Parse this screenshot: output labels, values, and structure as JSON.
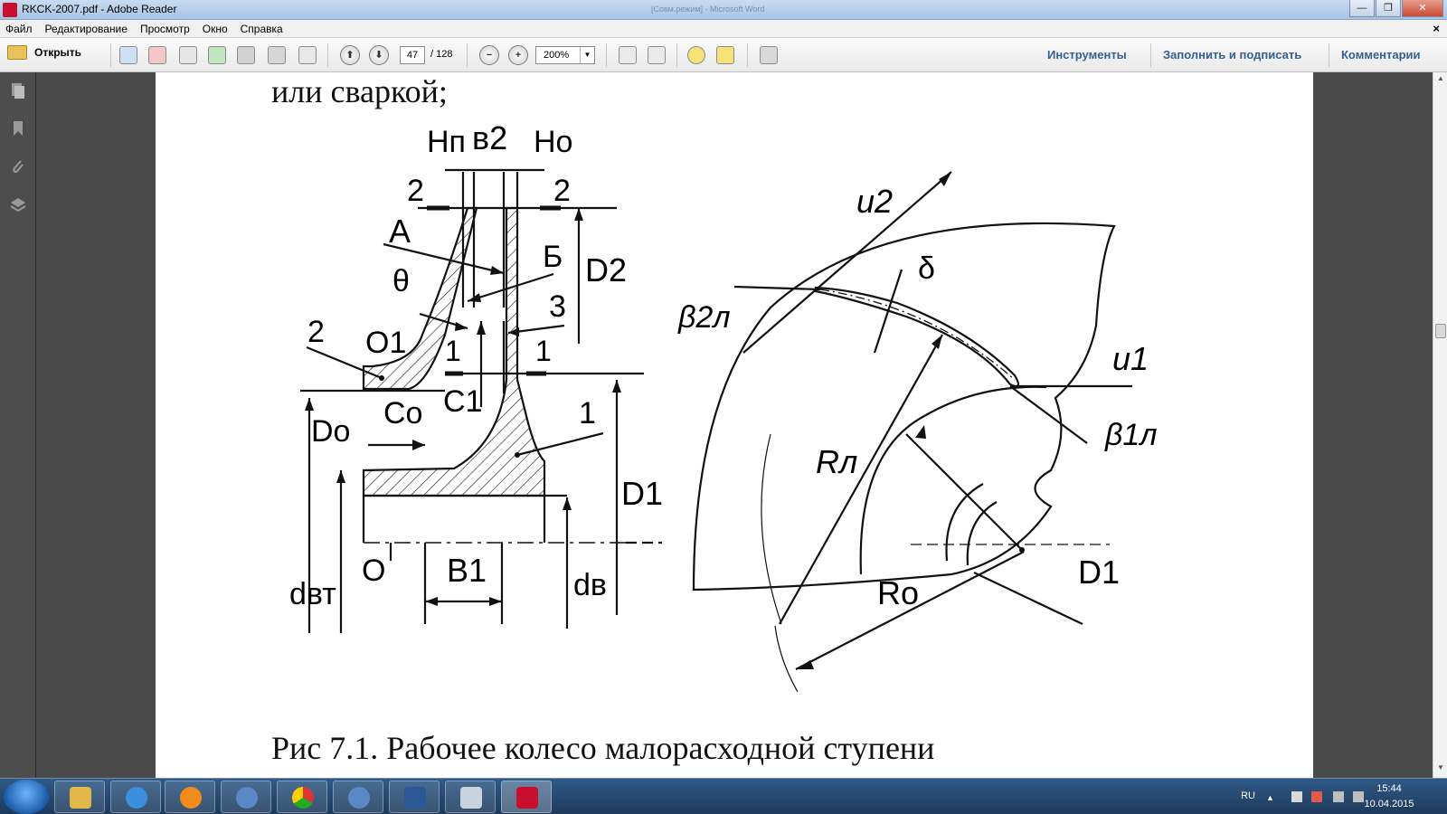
{
  "window": {
    "title": "RKCK-2007.pdf - Adobe Reader",
    "background_title": "[Совм.режим] - Microsoft Word",
    "buttons": {
      "minimize": "—",
      "maximize": "❐",
      "close": "✕"
    }
  },
  "menu": {
    "items": [
      "Файл",
      "Редактирование",
      "Просмотр",
      "Окно",
      "Справка"
    ],
    "close_glyph": "×"
  },
  "toolbar": {
    "open_label": "Открыть",
    "page_current": "47",
    "page_total": "/ 128",
    "zoom": "200%",
    "zoom_out": "−",
    "zoom_in": "+",
    "prev_page": "⬆",
    "next_page": "⬇",
    "tools_label": "Инструменты",
    "fill_sign_label": "Заполнить и подписать",
    "comments_label": "Комментарии"
  },
  "document": {
    "top_text": "или сваркой;",
    "caption": "Рис 7.1. Рабочее колесо малорасходной ступени",
    "figure": {
      "labels_left": {
        "Hn": "Hп",
        "b2": "в2",
        "Ho": "Hо",
        "two_left": "2",
        "two_right": "2",
        "A": "А",
        "B": "Б",
        "theta": "θ",
        "D2": "D2",
        "three": "3",
        "two_hub": "2",
        "O1": "O1",
        "one_a": "1",
        "one_b": "1",
        "Do": "Do",
        "Co": "Co",
        "C1": "C1",
        "one_c": "1",
        "D1": "D1",
        "O": "O",
        "dvt": "dвт",
        "B1": "B1",
        "dv": "dв"
      },
      "labels_right": {
        "u2": "u2",
        "delta": "δ",
        "beta2": "β2л",
        "u1": "u1",
        "beta1": "β1л",
        "Rl": "Rл",
        "Ro": "Rо",
        "D1": "D1"
      }
    }
  },
  "taskbar": {
    "lang": "RU",
    "time": "15:44",
    "date": "10.04.2015"
  },
  "colors": {
    "toolbar_accent": "#365f91",
    "pdf_red": "#c8102e",
    "taskbar": "#1e3a5c"
  }
}
